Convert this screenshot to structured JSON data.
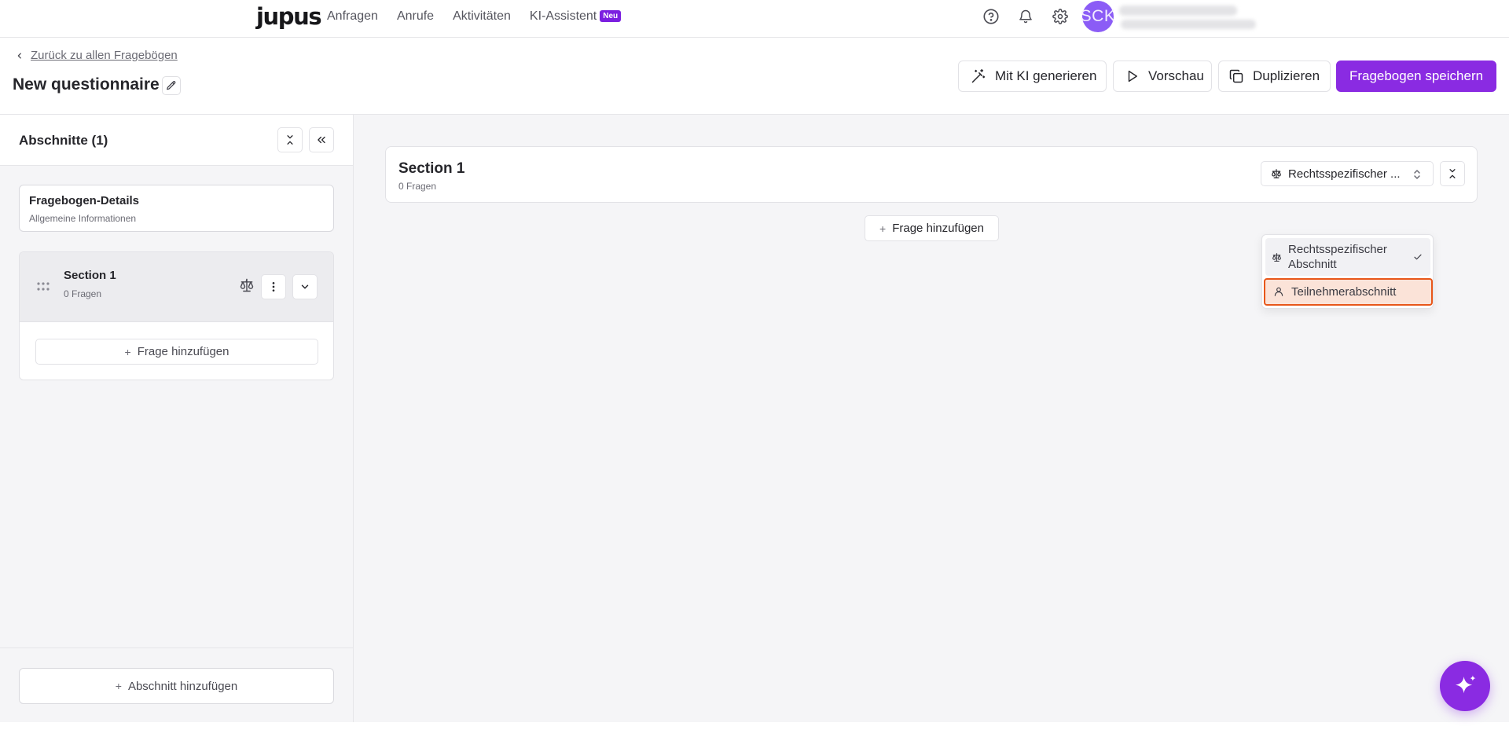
{
  "nav": {
    "logo": "jupus",
    "links": [
      "Anfragen",
      "Anrufe",
      "Aktivitäten",
      "KI-Assistent"
    ],
    "badge": "Neu",
    "avatar_initials": "SCK",
    "icons": [
      "help-circle-icon",
      "bell-icon",
      "gear-icon"
    ]
  },
  "header": {
    "back_label": "Zurück zu allen Fragebögen",
    "title": "New questionnaire",
    "buttons": {
      "ai": "Mit KI generieren",
      "preview": "Vorschau",
      "duplicate": "Duplizieren",
      "save": "Fragebogen speichern"
    }
  },
  "sidebar": {
    "title": "Abschnitte (1)",
    "details": {
      "title": "Fragebogen-Details",
      "subtitle": "Allgemeine Informationen"
    },
    "section": {
      "name": "Section 1",
      "count": "0 Fragen",
      "add_question": "Frage hinzufügen"
    },
    "add_section": "Abschnitt hinzufügen"
  },
  "main": {
    "section": {
      "name": "Section 1",
      "count": "0 Fragen",
      "type_value": "Rechtsspezifischer ..."
    },
    "add_question": "Frage hinzufügen"
  },
  "dropdown": {
    "options": [
      {
        "label": "Rechtsspezifischer Abschnitt",
        "icon": "scale-icon",
        "selected": true
      },
      {
        "label": "Teilnehmerabschnitt",
        "icon": "user-icon",
        "selected": false
      }
    ]
  },
  "colors": {
    "brand": "#8a2be2",
    "badge": "#7b1fe0",
    "avatar": "#8b5cf6",
    "highlight_border": "#e8571a",
    "highlight_fill": "#fbe3d8"
  }
}
